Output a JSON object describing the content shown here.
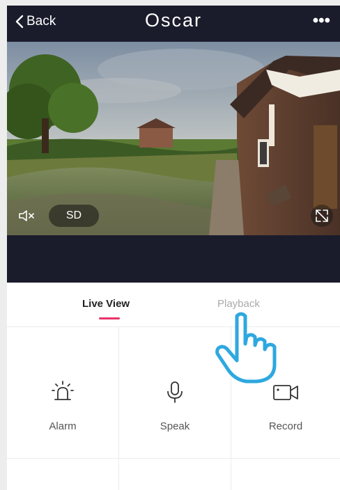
{
  "header": {
    "back_label": "Back",
    "title": "Oscar",
    "more_label": "•••"
  },
  "video": {
    "quality_label": "SD"
  },
  "tabs": [
    {
      "label": "Live View",
      "active": true
    },
    {
      "label": "Playback",
      "active": false
    }
  ],
  "actions": [
    {
      "label": "Alarm",
      "icon": "alarm-icon"
    },
    {
      "label": "Speak",
      "icon": "microphone-icon"
    },
    {
      "label": "Record",
      "icon": "video-camera-icon"
    }
  ],
  "colors": {
    "header_bg": "#1a1c2c",
    "accent": "#e8346a",
    "hand_outline": "#2ea8e0"
  }
}
